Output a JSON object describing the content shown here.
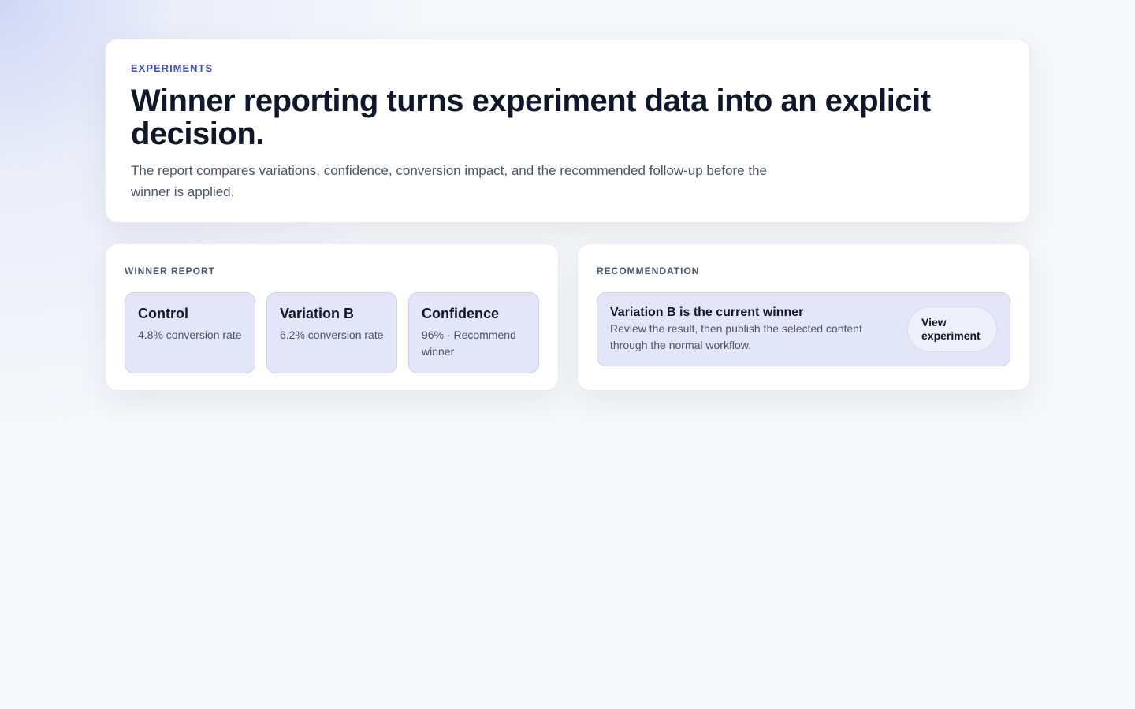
{
  "hero": {
    "eyebrow": "EXPERIMENTS",
    "title": "Winner reporting turns experiment data into an explicit decision.",
    "description": "The report compares variations, confidence, conversion impact, and the recommended follow-up before the winner is applied."
  },
  "winner_report": {
    "label": "WINNER REPORT",
    "metrics": [
      {
        "title": "Control",
        "value": "4.8% conversion rate"
      },
      {
        "title": "Variation B",
        "value": "6.2% conversion rate"
      },
      {
        "title": "Confidence",
        "value": "96% · Recommend winner"
      }
    ]
  },
  "recommendation": {
    "label": "RECOMMENDATION",
    "title": "Variation B is the current winner",
    "text": "Review the result, then publish the selected content through the normal workflow.",
    "button_label": "View experiment"
  },
  "colors": {
    "accent": "#3f51c2",
    "tile_background": "#e2e6f8",
    "heading": "#0f172a",
    "body_text": "#4b5568"
  }
}
